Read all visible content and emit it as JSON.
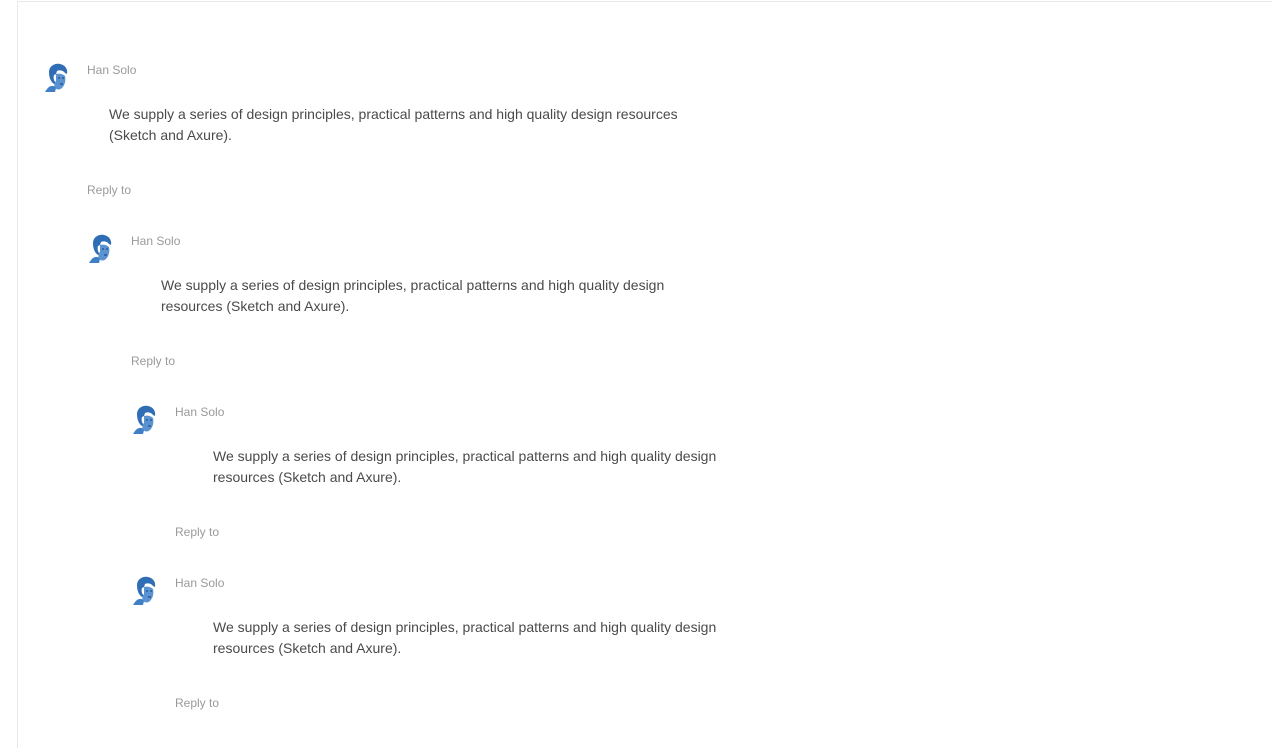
{
  "comments": [
    {
      "author": "Han Solo",
      "content": "We supply a series of design principles, practical patterns and high quality design resources (Sketch and Axure).",
      "reply_label": "Reply to"
    },
    {
      "author": "Han Solo",
      "content": "We supply a series of design principles, practical patterns and high quality design resources (Sketch and Axure).",
      "reply_label": "Reply to"
    },
    {
      "author": "Han Solo",
      "content": "We supply a series of design principles, practical patterns and high quality design resources (Sketch and Axure).",
      "reply_label": "Reply to"
    },
    {
      "author": "Han Solo",
      "content": "We supply a series of design principles, practical patterns and high quality design resources (Sketch and Axure).",
      "reply_label": "Reply to"
    }
  ],
  "colors": {
    "avatar": "#2f6db5",
    "text": "#4a4a4a",
    "muted": "#9a9a9a"
  }
}
